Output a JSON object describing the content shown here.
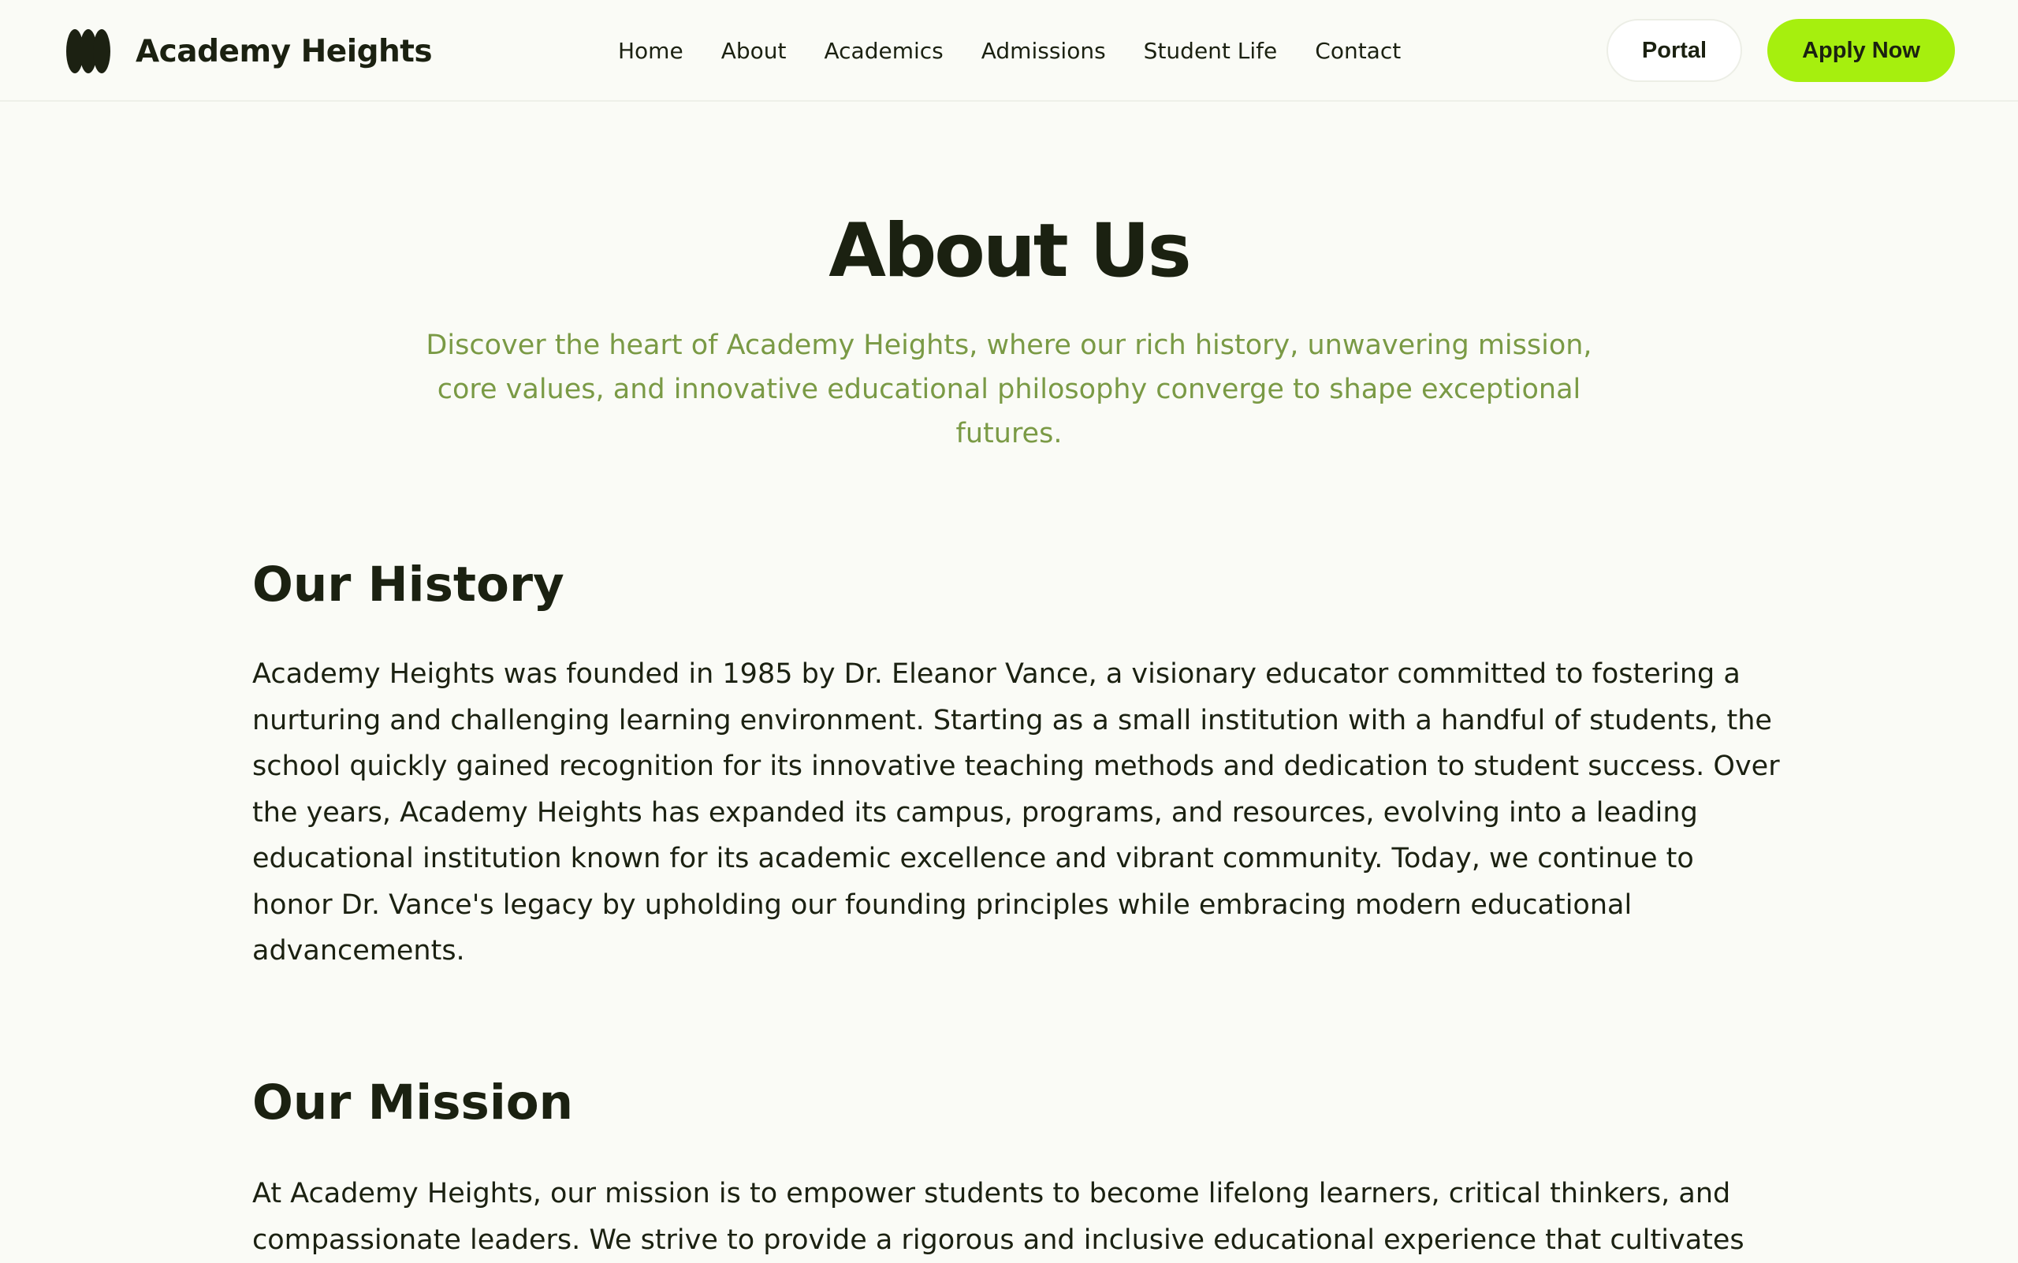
{
  "brand": {
    "name": "Academy Heights",
    "logo_icon": "academy-heights-logo-icon"
  },
  "nav": {
    "links": [
      "Home",
      "About",
      "Academics",
      "Admissions",
      "Student Life",
      "Contact"
    ],
    "portal_label": "Portal",
    "apply_label": "Apply Now"
  },
  "colors": {
    "accent": "#a6ef0e",
    "subtitle": "#7a9a45",
    "text": "#1b2111",
    "background": "#fafbf6"
  },
  "hero": {
    "title": "About Us",
    "subtitle": "Discover the heart of Academy Heights, where our rich history, unwavering mission, core values, and innovative educational philosophy converge to shape exceptional futures."
  },
  "sections": [
    {
      "heading": "Our History",
      "body": "Academy Heights was founded in 1985 by Dr. Eleanor Vance, a visionary educator committed to fostering a nurturing and challenging learning environment. Starting as a small institution with a handful of students, the school quickly gained recognition for its innovative teaching methods and dedication to student success. Over the years, Academy Heights has expanded its campus, programs, and resources, evolving into a leading educational institution known for its academic excellence and vibrant community. Today, we continue to honor Dr. Vance's legacy by upholding our founding principles while embracing modern educational advancements."
    },
    {
      "heading": "Our Mission",
      "body": "At Academy Heights, our mission is to empower students to become lifelong learners, critical thinkers, and compassionate leaders. We strive to provide a rigorous and inclusive educational experience that cultivates"
    }
  ]
}
